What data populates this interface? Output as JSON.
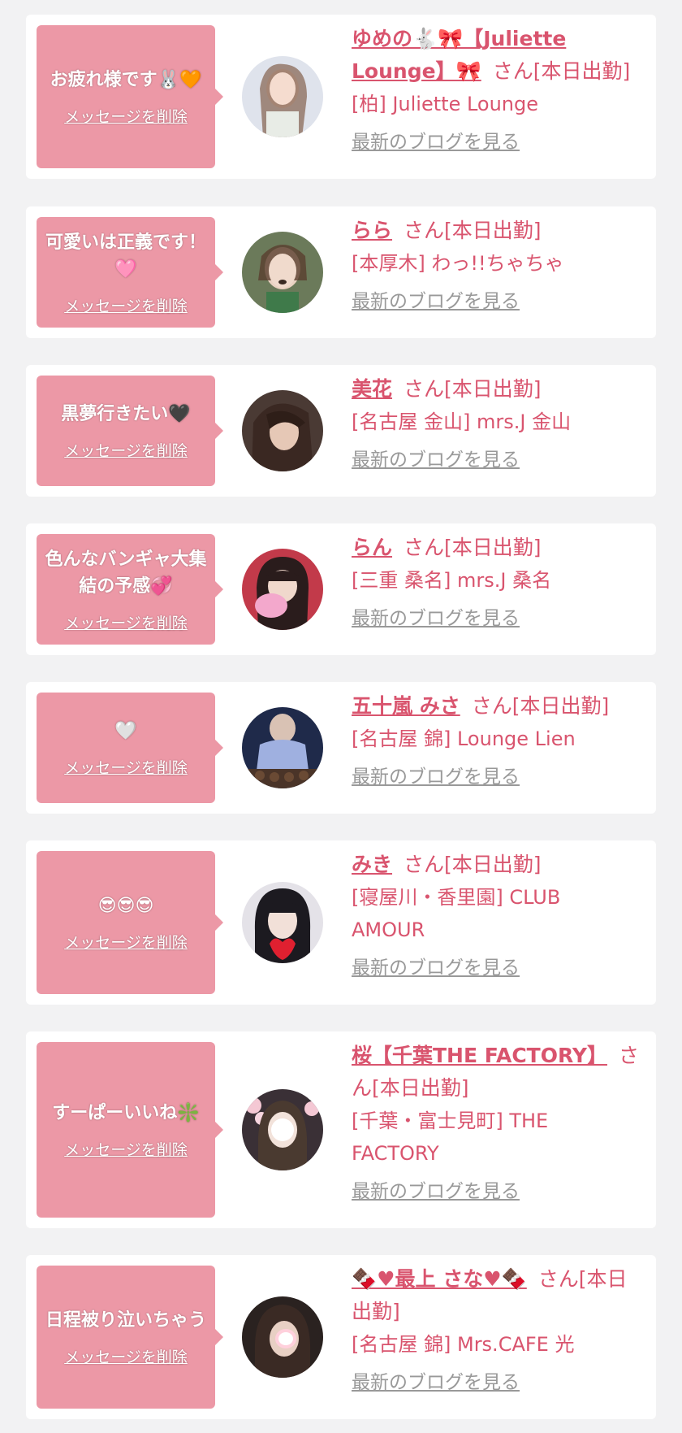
{
  "theme": {
    "accent": "#ec98a6",
    "name_color": "#d9546e",
    "link_gray": "#999999",
    "background": "#f2f2f3"
  },
  "items": [
    {
      "message": "お疲れ様です🐰🧡",
      "delete_label": "メッセージを削除",
      "name": "ゆめの🐇🎀【Juliette Lounge】🎀",
      "suffix": "さん[本日出勤]",
      "shop": "[柏] Juliette Lounge",
      "blog_label": "最新のブログを見る"
    },
    {
      "message": "可愛いは正義です！🩷",
      "delete_label": "メッセージを削除",
      "name": "らら",
      "suffix": "さん[本日出勤]",
      "shop": "[本厚木] わっ!!ちゃちゃ",
      "blog_label": "最新のブログを見る"
    },
    {
      "message": "黒夢行きたい🖤",
      "delete_label": "メッセージを削除",
      "name": "美花",
      "suffix": "さん[本日出勤]",
      "shop": "[名古屋 金山] mrs.J 金山",
      "blog_label": "最新のブログを見る"
    },
    {
      "message": "色んなバンギャ大集結の予感💞",
      "delete_label": "メッセージを削除",
      "name": "らん",
      "suffix": "さん[本日出勤]",
      "shop": "[三重 桑名] mrs.J 桑名",
      "blog_label": "最新のブログを見る"
    },
    {
      "message": "🤍",
      "delete_label": "メッセージを削除",
      "name": "五十嵐 みさ",
      "suffix": "さん[本日出勤]",
      "shop": "[名古屋 錦] Lounge Lien",
      "blog_label": "最新のブログを見る"
    },
    {
      "message": "😎😎😎",
      "delete_label": "メッセージを削除",
      "name": "みき",
      "suffix": "さん[本日出勤]",
      "shop": "[寝屋川・香里園] CLUB AMOUR",
      "blog_label": "最新のブログを見る"
    },
    {
      "message": "すーぱーいいね❇️",
      "delete_label": "メッセージを削除",
      "name": "桜【千葉THE FACTORY】",
      "suffix": "さん[本日出勤]",
      "shop": "[千葉・富士見町] THE FACTORY",
      "blog_label": "最新のブログを見る"
    },
    {
      "message": "日程被り泣いちゃう",
      "delete_label": "メッセージを削除",
      "name": "🍫♥最上 さな♥🍫",
      "suffix": "さん[本日出勤]",
      "shop": "[名古屋 錦] Mrs.CAFE 光",
      "blog_label": "最新のブログを見る"
    }
  ]
}
